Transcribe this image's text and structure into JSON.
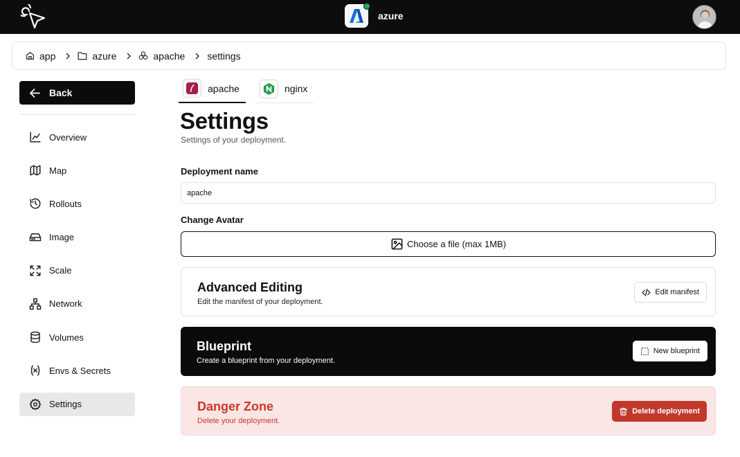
{
  "topbar": {
    "logo_icon": "cursor-click-icon",
    "project_name": "azure",
    "project_status_color": "#22a558",
    "user_avatar_icon": "user-avatar"
  },
  "breadcrumb": {
    "items": [
      {
        "label": "app",
        "icon": "home-icon"
      },
      {
        "label": "azure",
        "icon": "folder-icon"
      },
      {
        "label": "apache",
        "icon": "boxes-icon"
      },
      {
        "label": "settings",
        "icon": ""
      }
    ]
  },
  "sidebar": {
    "back_label": "Back",
    "items": [
      {
        "label": "Overview",
        "icon": "chart-line-icon"
      },
      {
        "label": "Map",
        "icon": "map-icon"
      },
      {
        "label": "Rollouts",
        "icon": "history-icon"
      },
      {
        "label": "Image",
        "icon": "hard-drive-icon"
      },
      {
        "label": "Scale",
        "icon": "expand-icon"
      },
      {
        "label": "Network",
        "icon": "network-icon"
      },
      {
        "label": "Volumes",
        "icon": "database-icon"
      },
      {
        "label": "Envs & Secrets",
        "icon": "variable-icon"
      },
      {
        "label": "Settings",
        "icon": "gear-icon",
        "active": true
      }
    ]
  },
  "tabs": [
    {
      "label": "apache",
      "icon": "apache-icon",
      "active": true
    },
    {
      "label": "nginx",
      "icon": "nginx-icon",
      "active": false
    }
  ],
  "main": {
    "title": "Settings",
    "subtitle": "Settings of your deployment.",
    "name_label": "Deployment name",
    "name_value": "apache",
    "avatar_label": "Change Avatar",
    "file_button": "Choose a file (max 1MB)",
    "advanced": {
      "title": "Advanced Editing",
      "desc": "Edit the manifest of your deployment.",
      "button": "Edit manifest"
    },
    "blueprint": {
      "title": "Blueprint",
      "desc": "Create a blueprint from your deployment.",
      "button": "New blueprint"
    },
    "danger": {
      "title": "Danger Zone",
      "desc": "Delete your deployment.",
      "button": "Delete deployment",
      "color": "#c9372c"
    }
  }
}
